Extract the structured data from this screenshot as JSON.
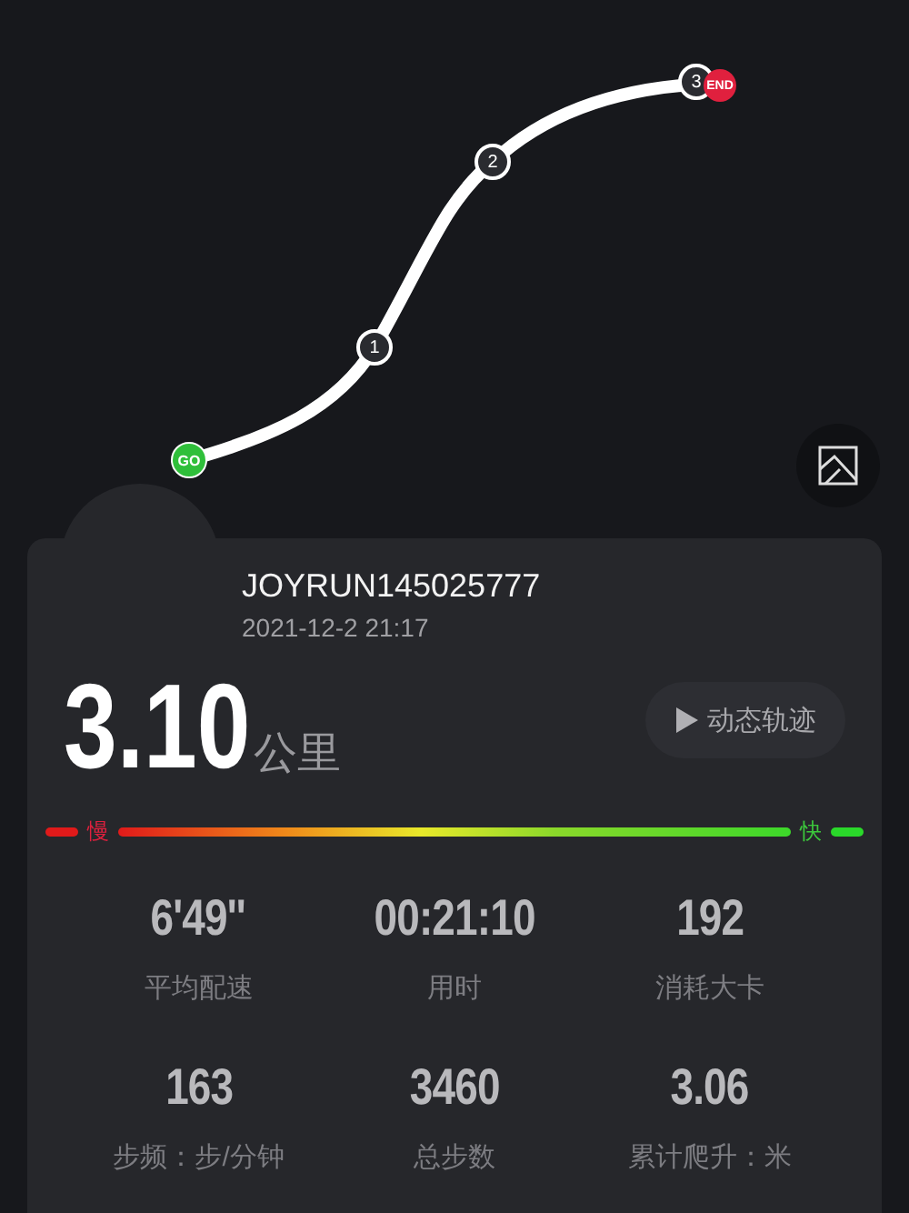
{
  "map": {
    "markers": [
      {
        "kind": "start",
        "label": "GO"
      },
      {
        "kind": "split",
        "label": "1"
      },
      {
        "kind": "split",
        "label": "2"
      },
      {
        "kind": "split",
        "label": "3"
      },
      {
        "kind": "end",
        "label": "END"
      }
    ]
  },
  "summary": {
    "username": "JOYRUN145025777",
    "datetime": "2021-12-2 21:17",
    "distance": "3.10",
    "distance_unit": "公里",
    "replay_button": "动态轨迹"
  },
  "pace_scale": {
    "slow_label": "慢",
    "fast_label": "快"
  },
  "stats": [
    {
      "value": "6'49''",
      "label": "平均配速"
    },
    {
      "value": "00:21:10",
      "label": "用时"
    },
    {
      "value": "192",
      "label": "消耗大卡"
    },
    {
      "value": "163",
      "label": "步频：步/分钟"
    },
    {
      "value": "3460",
      "label": "总步数"
    },
    {
      "value": "3.06",
      "label": "累计爬升：米"
    }
  ]
}
